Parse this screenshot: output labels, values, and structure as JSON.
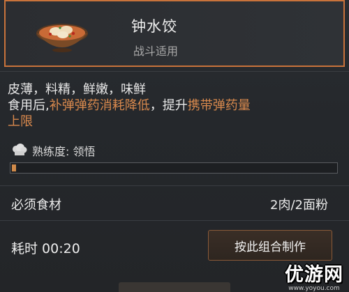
{
  "dish": {
    "name": "钟水饺",
    "tag": "战斗适用",
    "icon": "dumpling-bowl-icon"
  },
  "description": {
    "line1": "皮薄，料精，鲜嫩，味鲜",
    "line2_prefix": "食用后,",
    "line2_highlight1": "补弹弹药消耗降低",
    "line2_mid": "，提升",
    "line2_highlight2": "携带弹药量",
    "line3_highlight": "上限",
    "highlight_color": "#d9894d"
  },
  "proficiency": {
    "label": "熟练度: 领悟",
    "progress_fraction": 0.01
  },
  "ingredients": {
    "label": "必须食材",
    "value": "2肉/2面粉"
  },
  "time": {
    "label": "耗时 00:20"
  },
  "craft_button": {
    "label": "按此组合制作"
  },
  "watermark": {
    "main": "优游网",
    "sub": "www.yoyou.com"
  }
}
